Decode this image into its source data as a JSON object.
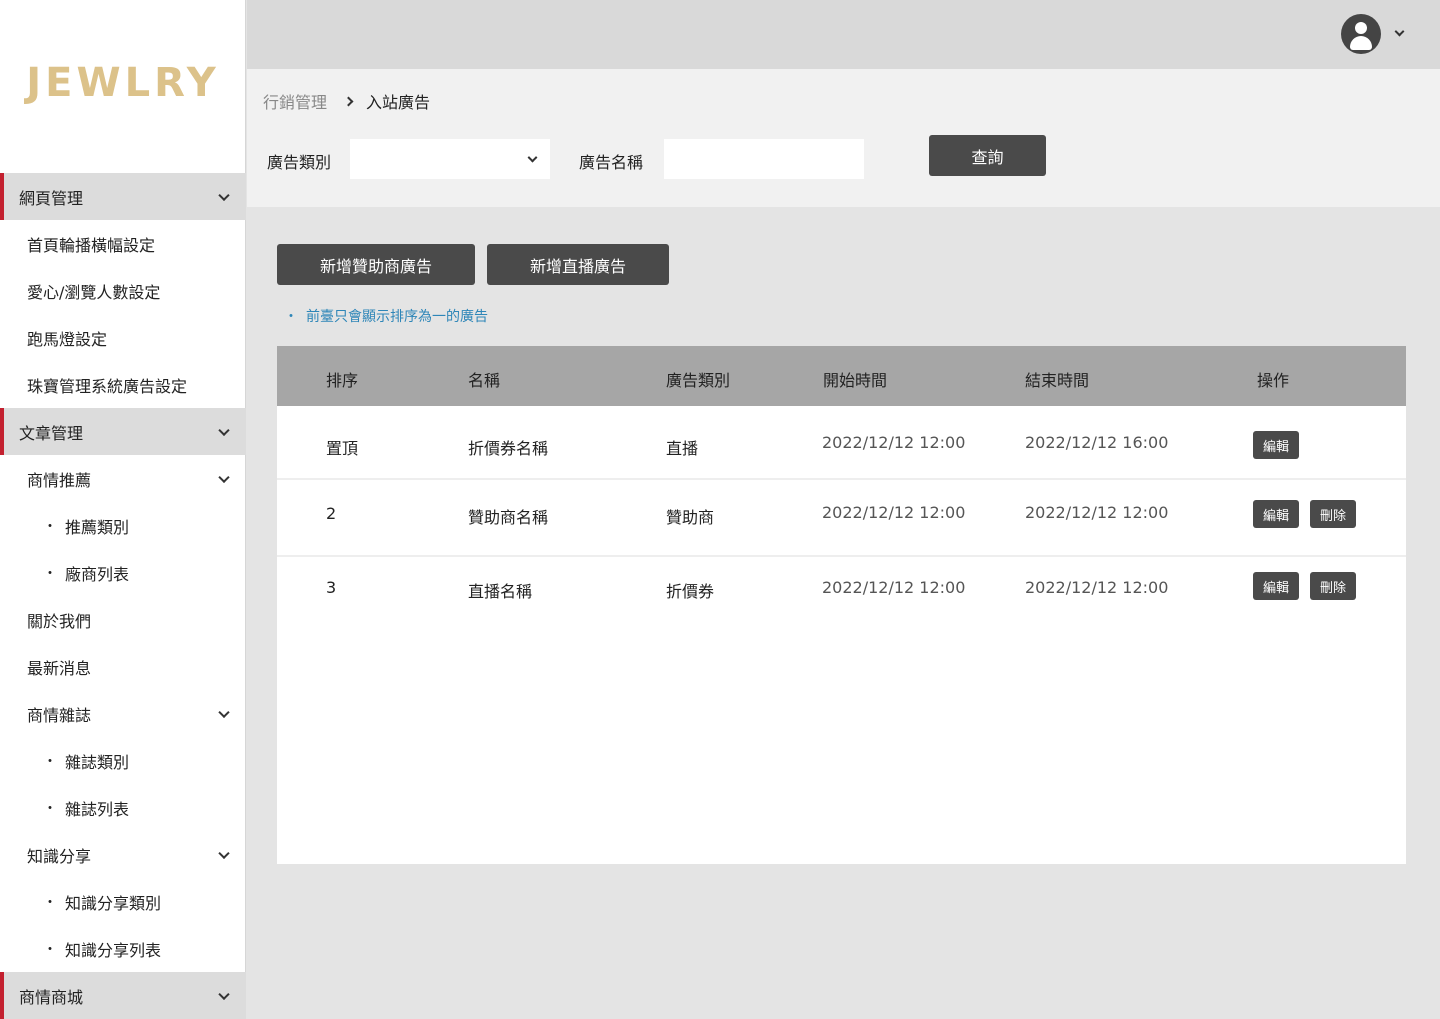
{
  "brand": {
    "logo_text": "JEWLRY",
    "logo_color": "#dcc28a",
    "accent_color": "#c3202f"
  },
  "sidebar": {
    "items": [
      {
        "label": "網頁管理",
        "type": "section",
        "expandable": true
      },
      {
        "label": "首頁輪播橫幅設定",
        "type": "sub"
      },
      {
        "label": "愛心/瀏覽人數設定",
        "type": "sub"
      },
      {
        "label": "跑馬燈設定",
        "type": "sub"
      },
      {
        "label": "珠寶管理系統廣告設定",
        "type": "sub"
      },
      {
        "label": "文章管理",
        "type": "section",
        "expandable": true
      },
      {
        "label": "商情推薦",
        "type": "sub",
        "expandable": true
      },
      {
        "label": "推薦類別",
        "type": "leaf",
        "bullet": "・"
      },
      {
        "label": "廠商列表",
        "type": "leaf",
        "bullet": "・"
      },
      {
        "label": "關於我們",
        "type": "sub"
      },
      {
        "label": "最新消息",
        "type": "sub"
      },
      {
        "label": "商情雜誌",
        "type": "sub",
        "expandable": true
      },
      {
        "label": "雜誌類別",
        "type": "leaf",
        "bullet": "・"
      },
      {
        "label": "雜誌列表",
        "type": "leaf",
        "bullet": "・"
      },
      {
        "label": "知識分享",
        "type": "sub",
        "expandable": true
      },
      {
        "label": "知識分享類別",
        "type": "leaf",
        "bullet": "・"
      },
      {
        "label": "知識分享列表",
        "type": "leaf",
        "bullet": "・"
      },
      {
        "label": "商情商城",
        "type": "section",
        "expandable": true
      }
    ]
  },
  "topbar": {
    "avatar_icon": "user-icon",
    "dropdown_icon": "chevron-down-icon"
  },
  "breadcrumb": {
    "parent": "行銷管理",
    "current": "入站廣告"
  },
  "filters": {
    "category_label": "廣告類別",
    "category_value": "",
    "name_label": "廣告名稱",
    "name_value": "",
    "query_button": "查詢"
  },
  "actions": {
    "add_sponsor": "新增贊助商廣告",
    "add_live": "新增直播廣告"
  },
  "note": {
    "bullet": "・",
    "text": "前臺只會顯示排序為一的廣告"
  },
  "table": {
    "headers": [
      "排序",
      "名稱",
      "廣告類別",
      "開始時間",
      "結束時間",
      "操作"
    ],
    "rows": [
      {
        "order": "置頂",
        "name": "折價券名稱",
        "category": "直播",
        "start": "2022/12/12 12:00",
        "end": "2022/12/12 16:00",
        "edit": "編輯"
      },
      {
        "order": "2",
        "name": "贊助商名稱",
        "category": "贊助商",
        "start": "2022/12/12 12:00",
        "end": "2022/12/12 12:00",
        "edit": "編輯",
        "delete": "刪除"
      },
      {
        "order": "3",
        "name": "直播名稱",
        "category": "折價券",
        "start": "2022/12/12 12:00",
        "end": "2022/12/12 12:00",
        "edit": "編輯",
        "delete": "刪除"
      }
    ]
  }
}
